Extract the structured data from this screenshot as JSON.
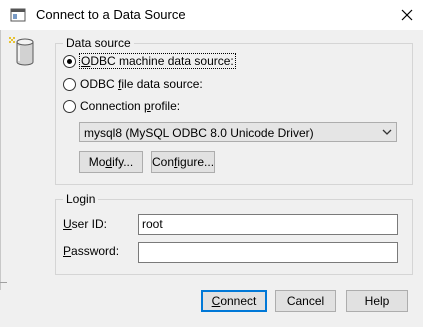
{
  "window": {
    "title": "Connect to a Data Source",
    "close_icon": "close-icon",
    "app_icon": "dialog-window-icon"
  },
  "data_source": {
    "group_label": "Data source",
    "icon": "database-icon",
    "options": [
      {
        "pre": "",
        "key": "O",
        "post": "DBC machine data source:",
        "checked": true,
        "focused": true
      },
      {
        "pre": "ODBC ",
        "key": "f",
        "post": "ile data source:",
        "checked": false,
        "focused": false
      },
      {
        "pre": "Connection ",
        "key": "p",
        "post": "rofile:",
        "checked": false,
        "focused": false
      }
    ],
    "selected_source": "mysql8 (MySQL ODBC 8.0 Unicode Driver)",
    "dropdown_icon": "chevron-down-icon",
    "modify_button": {
      "pre": "Mo",
      "key": "d",
      "post": "ify..."
    },
    "configure_button": {
      "pre": "Con",
      "key": "f",
      "post": "igure..."
    }
  },
  "login": {
    "group_label": "Login",
    "user_id_label": {
      "pre": "",
      "key": "U",
      "post": "ser ID:"
    },
    "user_id_value": "root",
    "password_label": {
      "pre": "",
      "key": "P",
      "post": "assword:"
    },
    "password_value": ""
  },
  "buttons": {
    "connect": {
      "pre": "",
      "key": "C",
      "post": "onnect"
    },
    "cancel": "Cancel",
    "help": "Help"
  }
}
